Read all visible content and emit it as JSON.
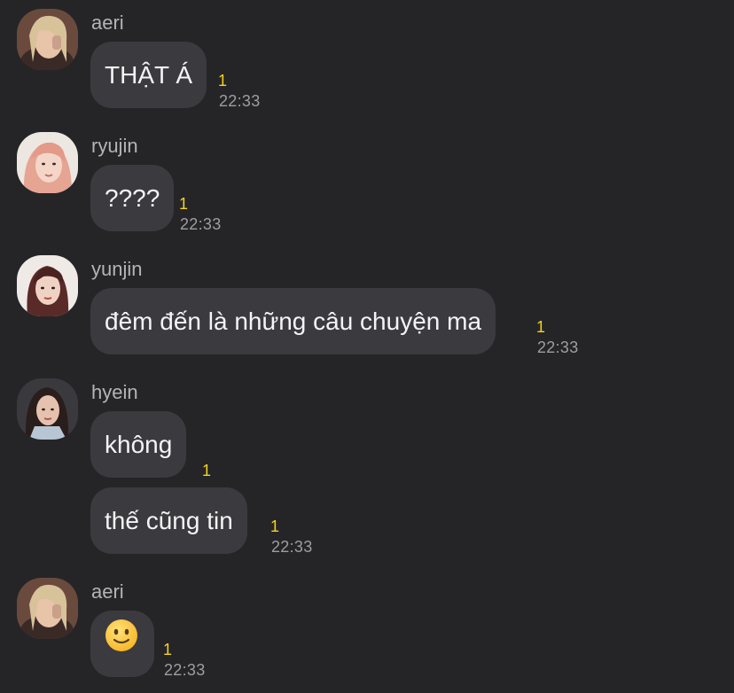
{
  "messages": [
    {
      "sender": "aeri",
      "text": "THẬT Á",
      "unread": "1",
      "time": "22:33"
    },
    {
      "sender": "ryujin",
      "text": "????",
      "unread": "1",
      "time": "22:33"
    },
    {
      "sender": "yunjin",
      "text": "đêm đến là những câu chuyện ma",
      "unread": "1",
      "time": "22:33"
    },
    {
      "sender": "hyein",
      "text": "không",
      "unread": "1"
    },
    {
      "text": "thế cũng tin",
      "unread": "1",
      "time": "22:33"
    },
    {
      "sender": "aeri",
      "emoji": "slightly-smiling-face-icon",
      "unread": "1",
      "time": "22:33"
    }
  ],
  "colors": {
    "background": "#252528",
    "bubble": "#3b3b3f",
    "unread": "#f5d321",
    "time": "#9d9da2"
  }
}
